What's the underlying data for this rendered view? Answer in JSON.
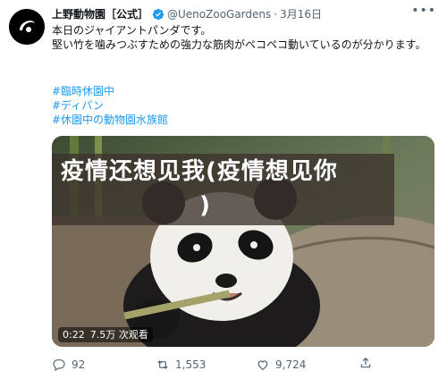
{
  "tweet": {
    "display_name": "上野動物園［公式］",
    "handle": "@UenoZooGardens",
    "separator": "·",
    "date": "3月16日",
    "more_label": "•••",
    "text": "本日のジャイアントパンダです。\n堅い竹を噛みつぶすための強力な筋肉がペコペコ動いているのが分かります。",
    "hashtags": [
      "#臨時休園中",
      "#ディパン",
      "#休園中の動物園水族館"
    ]
  },
  "media": {
    "overlay_line1": "疫情还想见我(疫情想见你",
    "overlay_line2": ")",
    "duration": "0:22",
    "views": "7.5万 次观看"
  },
  "actions": {
    "reply_count": "92",
    "retweet_count": "1,553",
    "like_count": "9,724"
  },
  "colors": {
    "link": "#1d9bf0",
    "secondary_text": "#536471",
    "verified": "#1d9bf0"
  },
  "icons": {
    "verified": "verified-badge-icon",
    "reply": "reply-icon",
    "retweet": "retweet-icon",
    "like": "heart-icon",
    "share": "share-icon",
    "more": "more-icon"
  }
}
